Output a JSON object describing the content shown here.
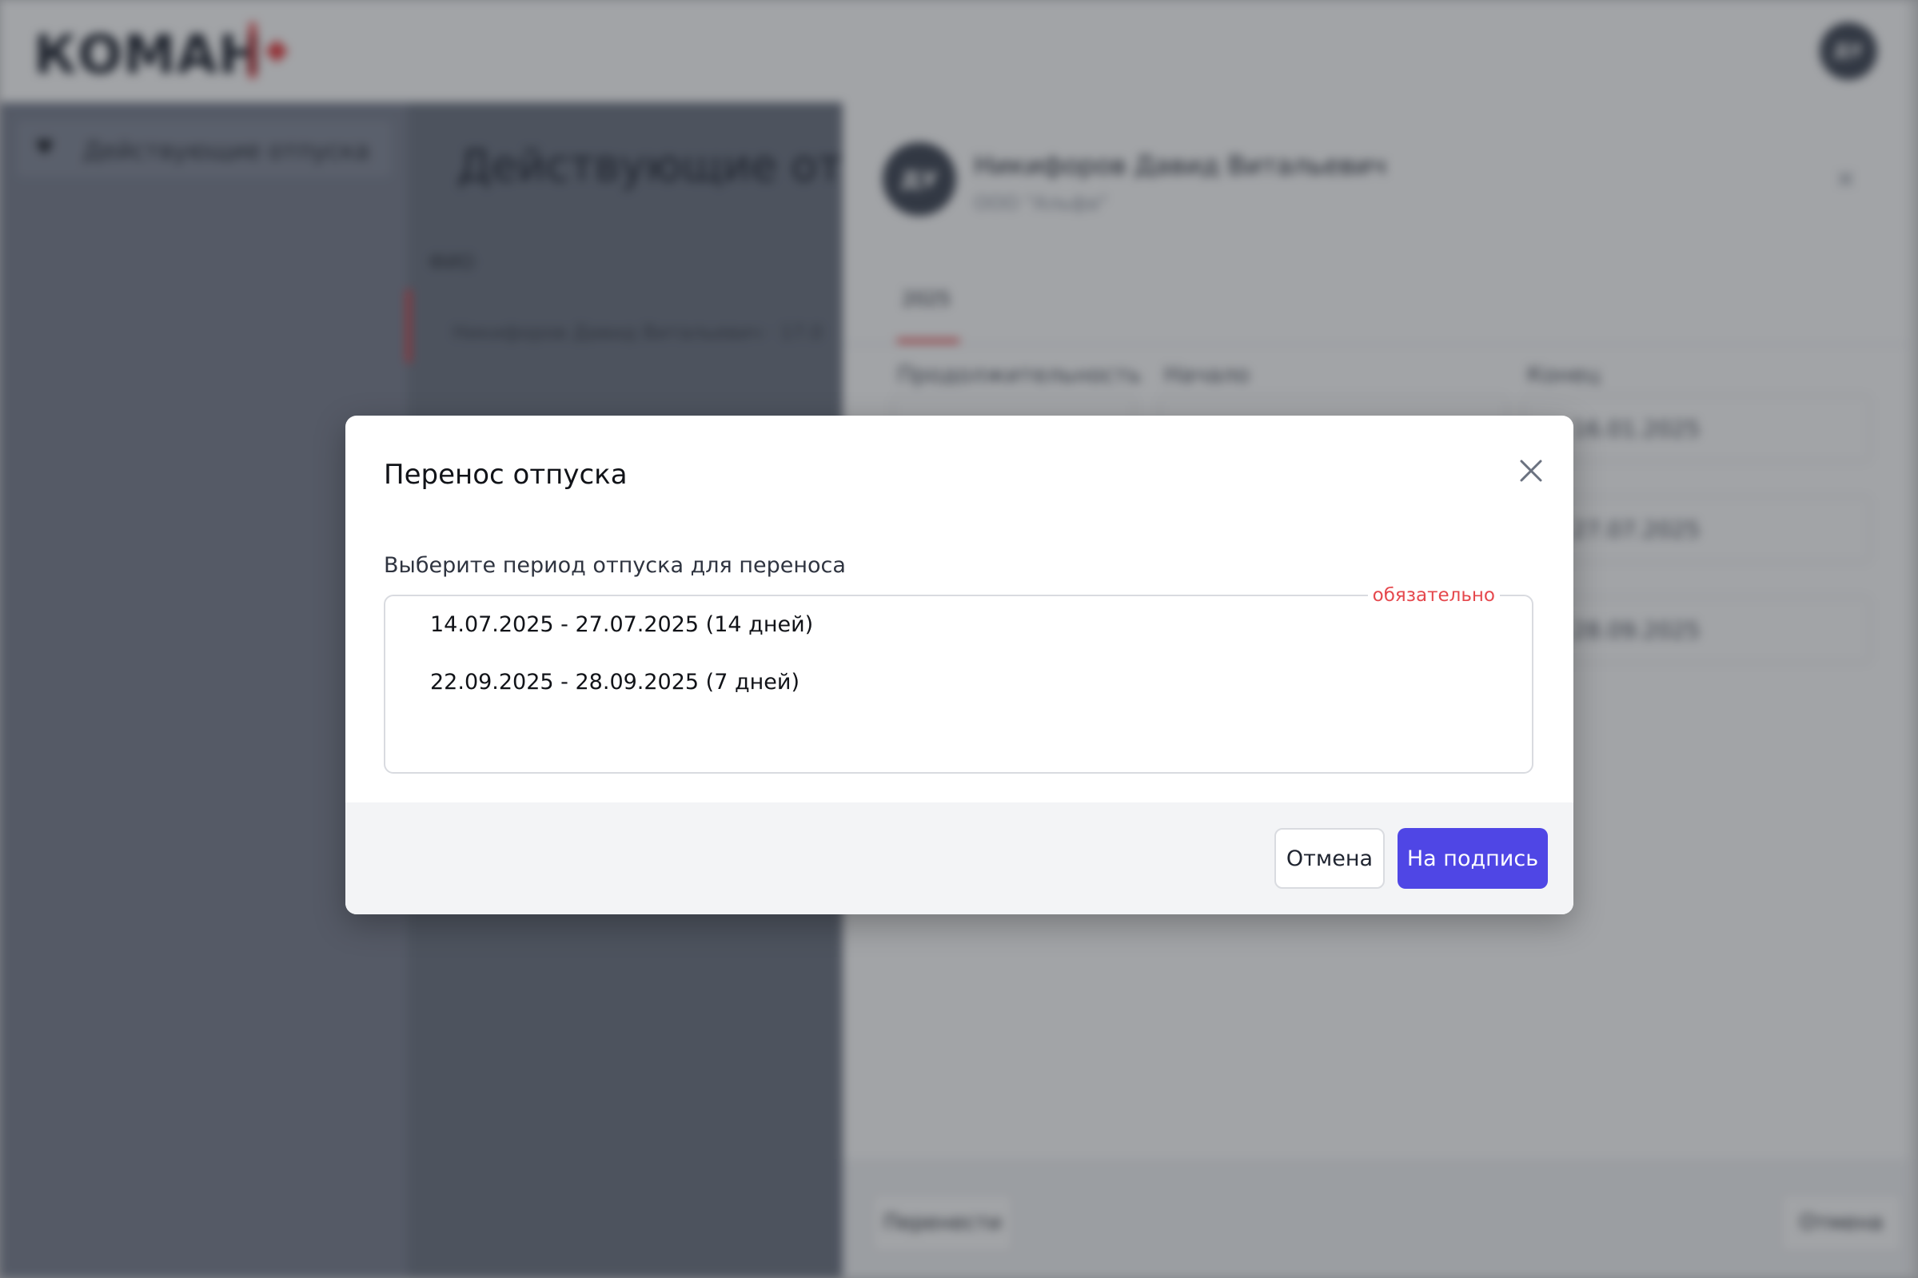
{
  "app": {
    "logo_text": "КОМАН",
    "user_initials": "ДУ"
  },
  "sidebar": {
    "items": [
      {
        "label": "Действующие отпуска"
      }
    ]
  },
  "list": {
    "title": "Действующие отпуска",
    "filter_label": "ФИО",
    "rows": [
      {
        "text": "Никифоров Давид Витальевич · 17.0"
      }
    ]
  },
  "panel": {
    "name": "Никифоров Давид Витальевич",
    "org": "ООО \"Альфа\"",
    "tab": "2025",
    "columns": [
      "Продолжительность",
      "Начало",
      "Конец"
    ],
    "rows": [
      {
        "end": "16.01.2025"
      },
      {
        "end": "27.07.2025"
      },
      {
        "end": "28.09.2025"
      }
    ],
    "footer": {
      "left_button": "Перенести",
      "right_button": "Отмена"
    }
  },
  "modal": {
    "title": "Перенос отпуска",
    "label": "Выберите период отпуска для переноса",
    "required_text": "обязательно",
    "options": [
      "14.07.2025 - 27.07.2025 (14 дней)",
      "22.09.2025 - 28.09.2025 (7 дней)"
    ],
    "cancel_label": "Отмена",
    "submit_label": "На подпись",
    "accent_color": "#4f46e5",
    "required_color": "#e5484d"
  }
}
